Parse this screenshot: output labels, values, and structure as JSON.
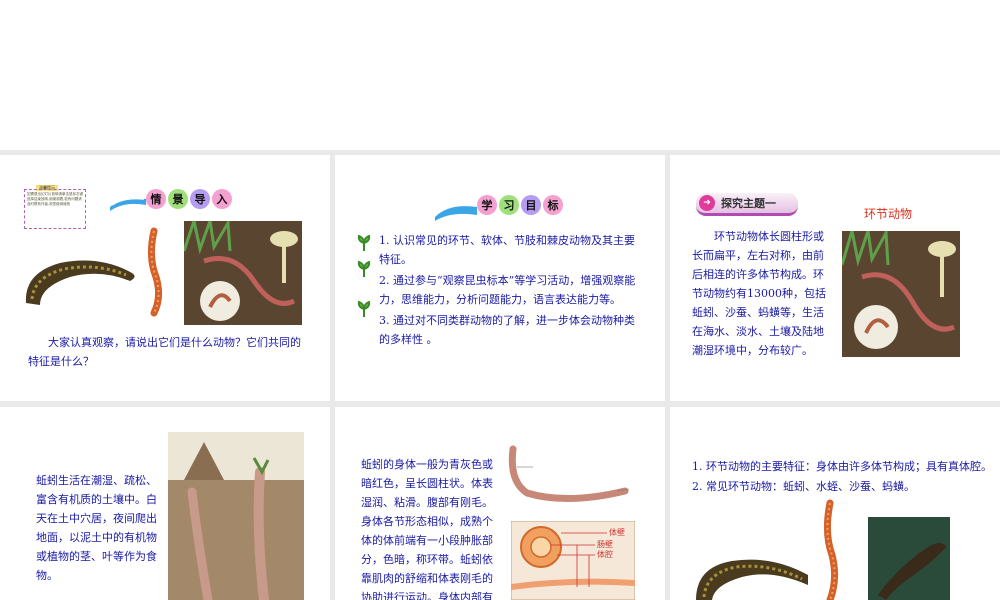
{
  "slide1": {
    "banner": [
      "情",
      "景",
      "导",
      "入"
    ],
    "note_tag": "温馨提示",
    "note_text": "如需退出幻灯片放映请单击鼠标右键选择结束放映,谢谢观看,若有问题请及时联系作者,祝您使用愉快",
    "body": "大家认真观察，请说出它们是什么动物？它们共同的特征是什么？"
  },
  "slide2": {
    "banner": [
      "学",
      "习",
      "目",
      "标"
    ],
    "goals": [
      "1. 认识常见的环节、软体、节肢和棘皮动物及其主要特征。",
      "2. 通过参与“观察昆虫标本”等学习活动，增强观察能力，思维能力，分析问题能力，语言表达能力等。",
      "3. 通过对不同类群动物的了解，进一步体会动物种类的多样性 。"
    ]
  },
  "slide3": {
    "tag": "探究主题一",
    "title": "环节动物",
    "body": "环节动物体长圆柱形或长而扁平，左右对称，由前后相连的许多体节构成。环节动物约有13000种，包括蚯蚓、沙蚕、蚂蟥等，生活在海水、淡水、土壤及陆地潮湿环境中，分布较广。"
  },
  "slide4": {
    "body": "蚯蚓生活在潮湿、疏松、富含有机质的土壤中。白天在土中穴居，夜间爬出地面，以泥土中的有机物或植物的茎、叶等作为食物。"
  },
  "slide5": {
    "body": "蚯蚓的身体一般为青灰色或暗红色，呈长圆柱状。体表湿润、粘滑。腹部有刚毛。身体各节形态相似，成熟个体的体前端有一小段肿胀部分，色暗，称环带。蚯蚓依靠肌肉的舒缩和体表刚毛的协助进行运动。身体内部有真体腔。",
    "labels": [
      "体壁",
      "肠壁",
      "体腔"
    ]
  },
  "slide6": {
    "points": [
      "1. 环节动物的主要特征：身体由许多体节构成；具有真体腔。",
      "2. 常见环节动物：蚯蚓、水蛭、沙蚕、蚂蟥。"
    ]
  },
  "colors": {
    "text_blue": "#1a1aa6",
    "title_red": "#e0301e",
    "bubble_pink": "#f4a0d0",
    "bubble_green": "#9fe07a",
    "bubble_purple": "#b59cf0"
  }
}
